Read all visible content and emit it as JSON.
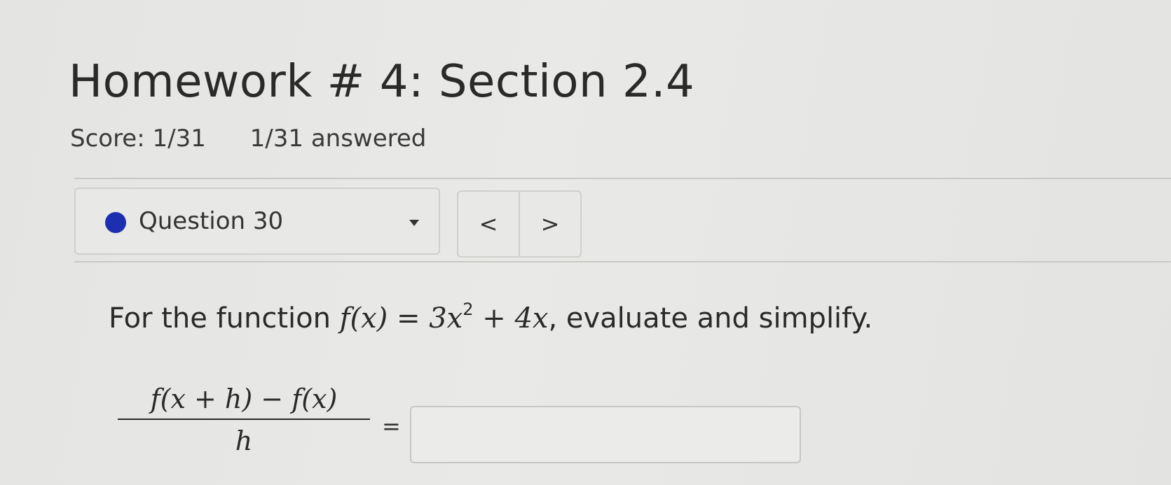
{
  "header": {
    "title": "Homework # 4: Section 2.4",
    "score": "Score: 1/31",
    "answered": "1/31 answered"
  },
  "question_nav": {
    "current_label": "Question 30",
    "status_color": "#1b2fb0",
    "prev_label": "<",
    "next_label": ">"
  },
  "question": {
    "prompt_lead": "For the function ",
    "function_lhs": "f(x) = 3x",
    "exponent": "2",
    "function_rhs": " + 4x",
    "prompt_tail": ", evaluate and simplify.",
    "numerator": "f(x + h) − f(x)",
    "denominator": "h",
    "equals": "=",
    "answer_value": ""
  }
}
